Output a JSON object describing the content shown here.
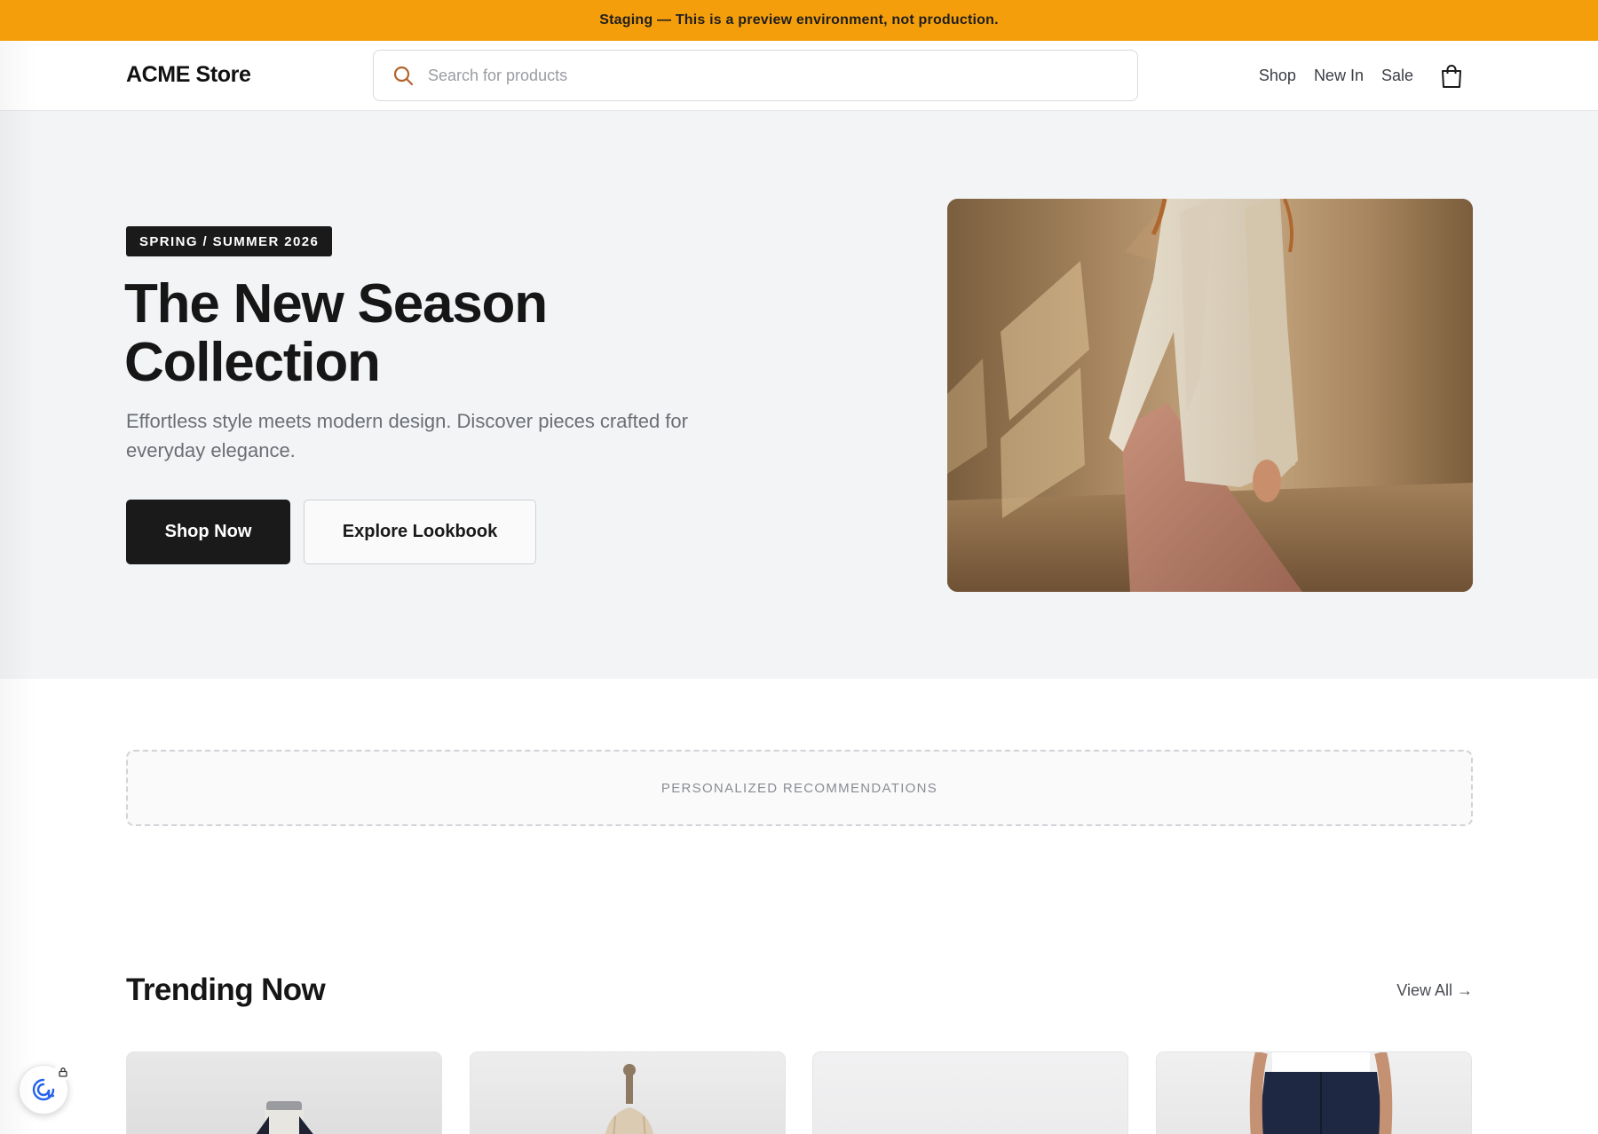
{
  "banner": {
    "text": "Staging — This is a preview environment, not production."
  },
  "header": {
    "logo": "ACME Store",
    "search": {
      "placeholder": "Search for products",
      "value": ""
    },
    "nav": [
      {
        "label": "Shop"
      },
      {
        "label": "New In"
      },
      {
        "label": "Sale"
      }
    ],
    "cart_icon": "shopping-bag-icon"
  },
  "hero": {
    "badge": "SPRING / SUMMER 2026",
    "title": "The New Season Collection",
    "subtitle": "Effortless style meets modern design. Discover pieces crafted for everyday elegance.",
    "primary_button": "Shop Now",
    "secondary_button": "Explore Lookbook"
  },
  "recommendations": {
    "label": "PERSONALIZED RECOMMENDATIONS"
  },
  "trending": {
    "title": "Trending Now",
    "view_all": "View All →"
  },
  "colors": {
    "banner": "#f59e0b",
    "primary": "#1a1a1a",
    "hero_bg": "#f3f4f6",
    "search_icon": "#b4622a",
    "assistant_icon": "#2563eb"
  }
}
